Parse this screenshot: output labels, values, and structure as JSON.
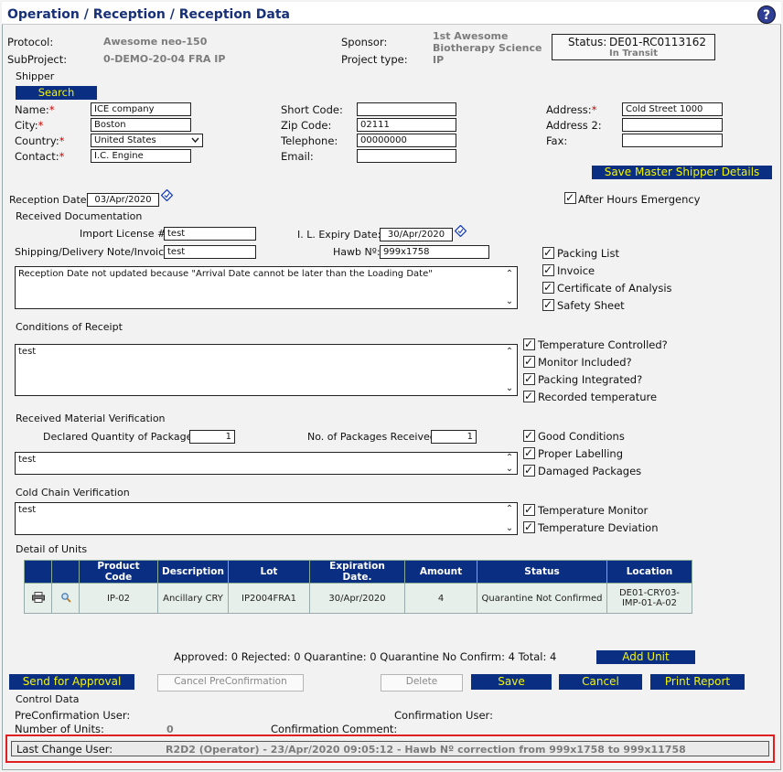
{
  "header": {
    "title": "Operation / Reception / Reception Data",
    "help": "?"
  },
  "info": {
    "protocol_label": "Protocol:",
    "protocol_value": "Awesome neo-150",
    "subproject_label": "SubProject:",
    "subproject_value": "0-DEMO-20-04 FRA IP",
    "sponsor_label": "Sponsor:",
    "sponsor_value_line1": "1st Awesome",
    "sponsor_value_line2": "Biotherapy Science",
    "project_type_label": "Project type:",
    "project_type_value": "IP",
    "status_label": "Status:",
    "status_value": "DE01-RC0113162",
    "status_sub": "In Transit"
  },
  "shipper": {
    "section": "Shipper",
    "search_button": "Search",
    "name_label": "Name:",
    "name_value": "ICE company",
    "city_label": "City:",
    "city_value": "Boston",
    "country_label": "Country:",
    "country_value": "United States",
    "contact_label": "Contact:",
    "contact_value": "I.C. Engine",
    "short_code_label": "Short Code:",
    "short_code_value": "",
    "zip_label": "Zip Code:",
    "zip_value": "02111",
    "telephone_label": "Telephone:",
    "telephone_value": "00000000",
    "email_label": "Email:",
    "email_value": "",
    "address_label": "Address:",
    "address_value": "Cold Street 1000",
    "address2_label": "Address 2:",
    "address2_value": "",
    "fax_label": "Fax:",
    "fax_value": "",
    "save_master_button": "Save Master Shipper Details",
    "required_mark": "*"
  },
  "reception": {
    "date_label": "Reception Date:",
    "date_value": "03/Apr/2020",
    "after_hours_label": "After Hours Emergency"
  },
  "documentation": {
    "section": "Received Documentation",
    "import_license_label": "Import License #:",
    "import_license_value": "test",
    "il_expiry_label": "I. L. Expiry Date:",
    "il_expiry_value": "30/Apr/2020",
    "shipping_note_label": "Shipping/Delivery Note/Invoice:",
    "shipping_note_value": "test",
    "hawb_label": "Hawb Nº:",
    "hawb_value": "999x1758",
    "notes": "Reception Date not updated because \"Arrival Date cannot be later than the Loading Date\"",
    "checks": [
      "Packing List",
      "Invoice",
      "Certificate of Analysis",
      "Safety Sheet"
    ]
  },
  "conditions": {
    "section": "Conditions of Receipt",
    "notes": "test",
    "checks": [
      "Temperature Controlled?",
      "Monitor Included?",
      "Packing Integrated?",
      "Recorded temperature"
    ]
  },
  "material": {
    "section": "Received Material Verification",
    "declared_label": "Declared Quantity of Packages:",
    "declared_value": "1",
    "received_label": "No. of Packages Received:",
    "received_value": "1",
    "notes": "test",
    "checks": [
      "Good Conditions",
      "Proper Labelling",
      "Damaged Packages"
    ]
  },
  "cold_chain": {
    "section": "Cold Chain Verification",
    "notes": "test",
    "checks": [
      "Temperature Monitor",
      "Temperature Deviation"
    ]
  },
  "units": {
    "section": "Detail of Units",
    "columns": [
      "Product Code",
      "Description",
      "Lot",
      "Expiration Date.",
      "Amount",
      "Status",
      "Location"
    ],
    "rows": [
      {
        "product_code": "IP-02",
        "description": "Ancillary CRY",
        "lot": "IP2004FRA1",
        "expiration": "30/Apr/2020",
        "amount": "4",
        "status": "Quarantine Not Confirmed",
        "location_line1": "DE01-CRY03-",
        "location_line2": "IMP-01-A-02"
      }
    ]
  },
  "summary": {
    "approved_label": "Approved:",
    "approved": "0",
    "rejected_label": "Rejected:",
    "rejected": "0",
    "quarantine_label": "Quarantine:",
    "quarantine": "0",
    "qnc_label": "Quarantine No Confirm:",
    "qnc": "4",
    "total_label": "Total:",
    "total": "4",
    "add_unit_button": "Add Unit"
  },
  "actions": {
    "send_approval": "Send for Approval",
    "cancel_preconfirmation": "Cancel PreConfirmation",
    "delete": "Delete",
    "save": "Save",
    "cancel": "Cancel",
    "print_report": "Print Report"
  },
  "control": {
    "section": "Control Data",
    "preconf_user_label": "PreConfirmation User:",
    "conf_user_label": "Confirmation User:",
    "num_units_label": "Number of Units:",
    "num_units_value": "0",
    "conf_comment_label": "Confirmation Comment:",
    "last_change_label": "Last Change User:",
    "last_change_value": "R2D2 (Operator) - 23/Apr/2020 09:05:12 - Hawb Nº correction from 999x1758 to 999x11758"
  },
  "colors": {
    "brand_navy": "#0a2e82",
    "button_text": "#f5f500",
    "title": "#17307a",
    "required": "#d00000",
    "highlight_border": "#e02020"
  }
}
